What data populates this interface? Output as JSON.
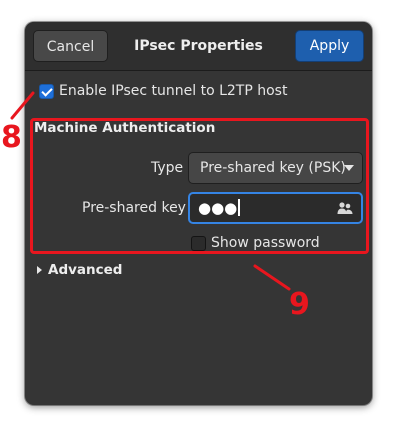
{
  "header": {
    "cancel_label": "Cancel",
    "title": "IPsec Properties",
    "apply_label": "Apply"
  },
  "enable_ipsec": {
    "label": "Enable IPsec tunnel to L2TP host",
    "checked": true
  },
  "machine_auth": {
    "section_title": "Machine Authentication",
    "type_label": "Type",
    "type_value": "Pre-shared key (PSK)",
    "psk_label": "Pre-shared key",
    "psk_value": "●●●",
    "show_password_label": "Show password",
    "show_password_checked": false
  },
  "advanced": {
    "label": "Advanced"
  },
  "annotations": {
    "marker_8": "8",
    "marker_9": "9",
    "color": "#e8161e"
  },
  "colors": {
    "accent": "#1e5fae",
    "focus": "#3584e4",
    "dialog_bg": "#353535"
  }
}
